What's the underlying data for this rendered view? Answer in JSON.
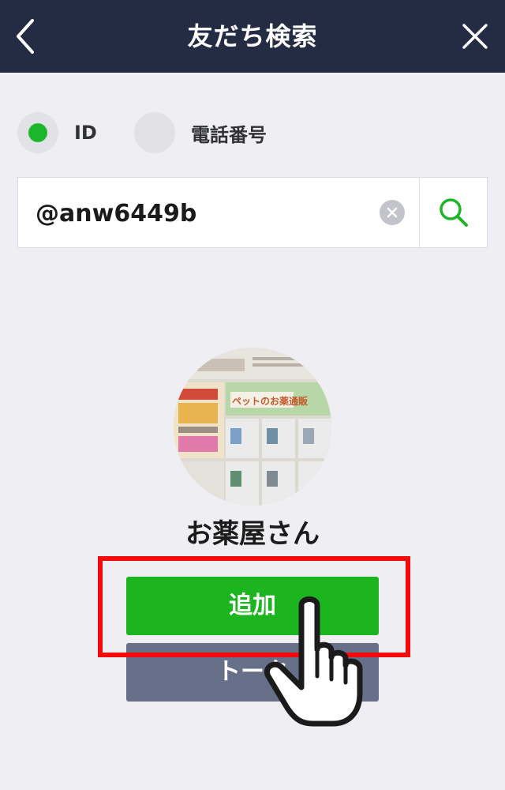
{
  "header": {
    "title": "友だち検索",
    "back_icon": "chevron-left-icon",
    "close_icon": "close-icon",
    "background": "#242c43"
  },
  "search_type": {
    "options": [
      {
        "label": "ID",
        "selected": true
      },
      {
        "label": "電話番号",
        "selected": false
      }
    ],
    "accent": "#1db52a"
  },
  "search": {
    "value": "@anw6449b",
    "clear_icon": "clear-icon",
    "search_icon": "search-icon"
  },
  "profile": {
    "name": "お薬屋さん",
    "avatar_caption": "ペットのお薬通販"
  },
  "actions": {
    "add_label": "追加",
    "talk_label": "トーク",
    "add_color": "#1cb51f",
    "talk_color": "#667088"
  },
  "annotation": {
    "highlight_color": "#f40a0a",
    "pointer_icon": "hand-pointer-icon"
  }
}
